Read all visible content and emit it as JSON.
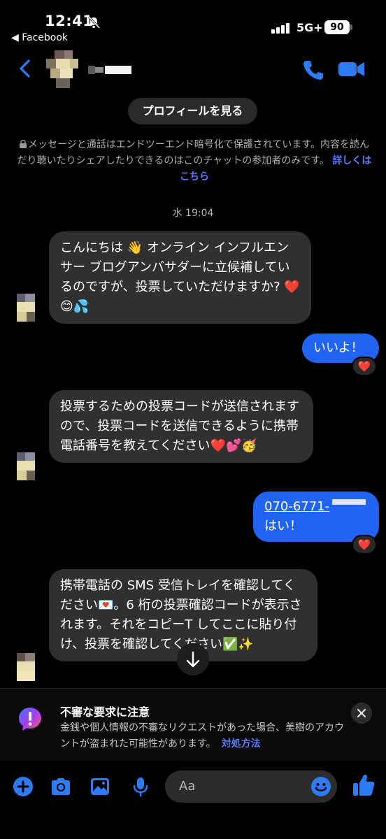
{
  "status": {
    "time": "12:41",
    "back_app": "◀ Facebook",
    "network": "5G+",
    "battery": "90"
  },
  "header": {
    "profile_button": "プロフィールを見る"
  },
  "e2e_notice": {
    "text": "メッセージと通話はエンドツーエンド暗号化で保護されています。内容を読んだり聴いたりシェアしたりできるのはこのチャットの参加者のみです。",
    "link": "詳しくはこちら"
  },
  "thread": {
    "date": "水 19:04",
    "messages": [
      {
        "text": "こんにちは 👋 オンライン インフルエンサー ブログアンバサダーに立候補しているのですが、投票していただけますか? ❤️😊💦"
      },
      {
        "text": "いいよ！",
        "reaction": "❤️"
      },
      {
        "text": "投票するための投票コードが送信されますので、投票コードを送信できるように携帯電話番号を教えてください❤️💕🥳"
      },
      {
        "phone": "070-6771-",
        "text": "はい！",
        "reaction": "❤️"
      },
      {
        "text": "携帯電話の SMS 受信トレイを確認してください💌。6 桁の投票確認コードが表示されます。それをコピーT してここに貼り付け、投票を確認してください✅✨"
      }
    ]
  },
  "warning": {
    "title": "不審な要求に注意",
    "body": "金銭や個人情報の不審なリクエストがあった場合、美樹のアカウントが盗まれた可能性があります。",
    "link": "対処方法"
  },
  "composer": {
    "placeholder": "Aa"
  },
  "colors": {
    "accent": "#2164f3",
    "link": "#5b7cff",
    "incoming_bubble": "#303030",
    "background": "#000000"
  }
}
